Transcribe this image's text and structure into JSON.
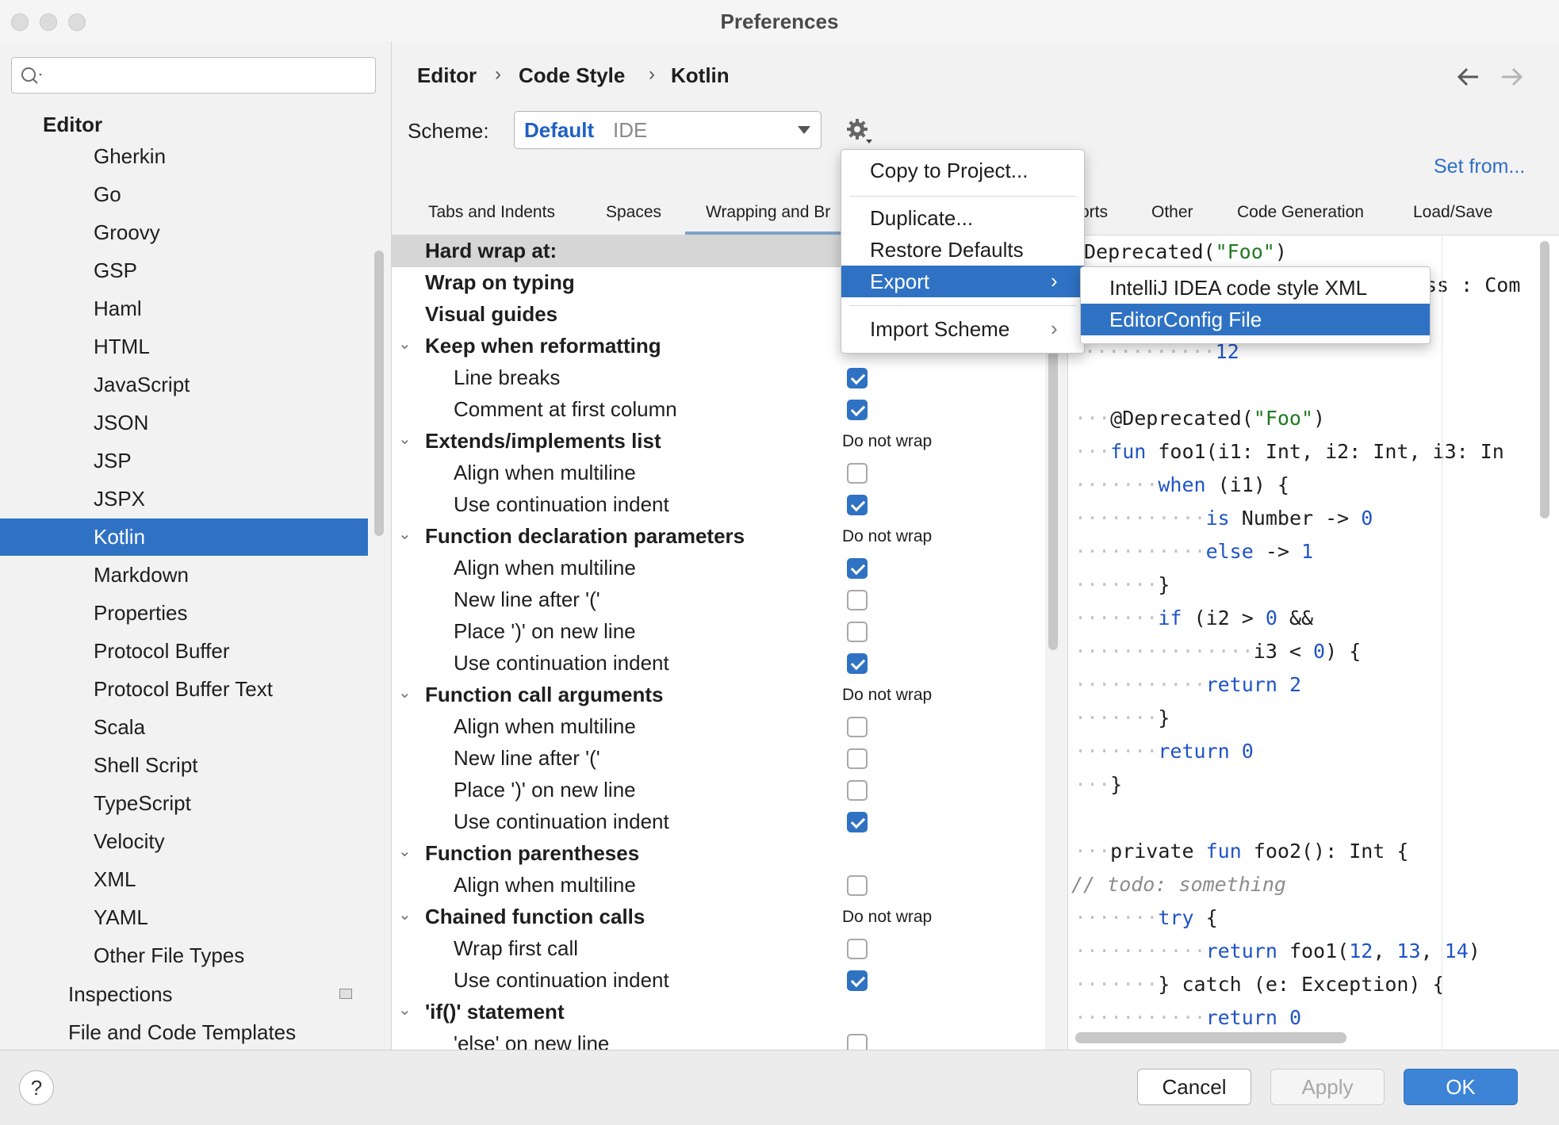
{
  "window": {
    "title": "Preferences"
  },
  "sidebar": {
    "search_placeholder": "",
    "section": "Editor",
    "items": [
      "Gherkin",
      "Go",
      "Groovy",
      "GSP",
      "Haml",
      "HTML",
      "JavaScript",
      "JSON",
      "JSP",
      "JSPX",
      "Kotlin",
      "Markdown",
      "Properties",
      "Protocol Buffer",
      "Protocol Buffer Text",
      "Scala",
      "Shell Script",
      "TypeScript",
      "Velocity",
      "XML",
      "YAML",
      "Other File Types"
    ],
    "selected": "Kotlin",
    "inspections": "Inspections",
    "file_templates": "File and Code Templates"
  },
  "breadcrumb": [
    "Editor",
    "Code Style",
    "Kotlin"
  ],
  "nav": {
    "back_icon": "arrow-left-icon",
    "forward_icon": "arrow-right-icon"
  },
  "scheme": {
    "label": "Scheme:",
    "name": "Default",
    "type": "IDE",
    "gear_icon": "gear-icon"
  },
  "set_from": "Set from...",
  "tabs": [
    "Tabs and Indents",
    "Spaces",
    "Wrapping and Br",
    "orts",
    "Other",
    "Code Generation",
    "Load/Save"
  ],
  "active_tab": "Wrapping and Braces",
  "settings": [
    {
      "label": "Hard wrap at:",
      "bold": true,
      "hl": true
    },
    {
      "label": "Wrap on typing",
      "bold": true
    },
    {
      "label": "Visual guides",
      "bold": true
    },
    {
      "label": "Keep when reformatting",
      "bold": true,
      "group": true
    },
    {
      "label": "Line breaks",
      "checked": true
    },
    {
      "label": "Comment at first column",
      "checked": true
    },
    {
      "label": "Extends/implements list",
      "bold": true,
      "group": true,
      "value": "Do not wrap"
    },
    {
      "label": "Align when multiline",
      "checked": false
    },
    {
      "label": "Use continuation indent",
      "checked": true
    },
    {
      "label": "Function declaration parameters",
      "bold": true,
      "group": true,
      "value": "Do not wrap"
    },
    {
      "label": "Align when multiline",
      "checked": true
    },
    {
      "label": "New line after '('",
      "checked": false
    },
    {
      "label": "Place ')' on new line",
      "checked": false
    },
    {
      "label": "Use continuation indent",
      "checked": true
    },
    {
      "label": "Function call arguments",
      "bold": true,
      "group": true,
      "value": "Do not wrap"
    },
    {
      "label": "Align when multiline",
      "checked": false
    },
    {
      "label": "New line after '('",
      "checked": false
    },
    {
      "label": "Place ')' on new line",
      "checked": false
    },
    {
      "label": "Use continuation indent",
      "checked": true
    },
    {
      "label": "Function parentheses",
      "bold": true,
      "group": true
    },
    {
      "label": "Align when multiline",
      "checked": false
    },
    {
      "label": "Chained function calls",
      "bold": true,
      "group": true,
      "value": "Do not wrap"
    },
    {
      "label": "Wrap first call",
      "checked": false
    },
    {
      "label": "Use continuation indent",
      "checked": true
    },
    {
      "label": "'if()' statement",
      "bold": true,
      "group": true
    },
    {
      "label": "'else' on new line",
      "checked": false
    }
  ],
  "menu": {
    "copy_to_project": "Copy to Project...",
    "duplicate": "Duplicate...",
    "restore_defaults": "Restore Defaults",
    "export": "Export",
    "import_scheme": "Import Scheme"
  },
  "export_submenu": {
    "intellij_xml": "IntelliJ IDEA code style XML",
    "editorconfig": "EditorConfig File"
  },
  "buttons": {
    "help": "?",
    "cancel": "Cancel",
    "apply": "Apply",
    "ok": "OK"
  },
  "colors": {
    "selection": "#2f72c4",
    "ok_button": "#3d84d6",
    "keyword": "#1f54c6",
    "string": "#217a21",
    "link": "#2f6fc5"
  }
}
